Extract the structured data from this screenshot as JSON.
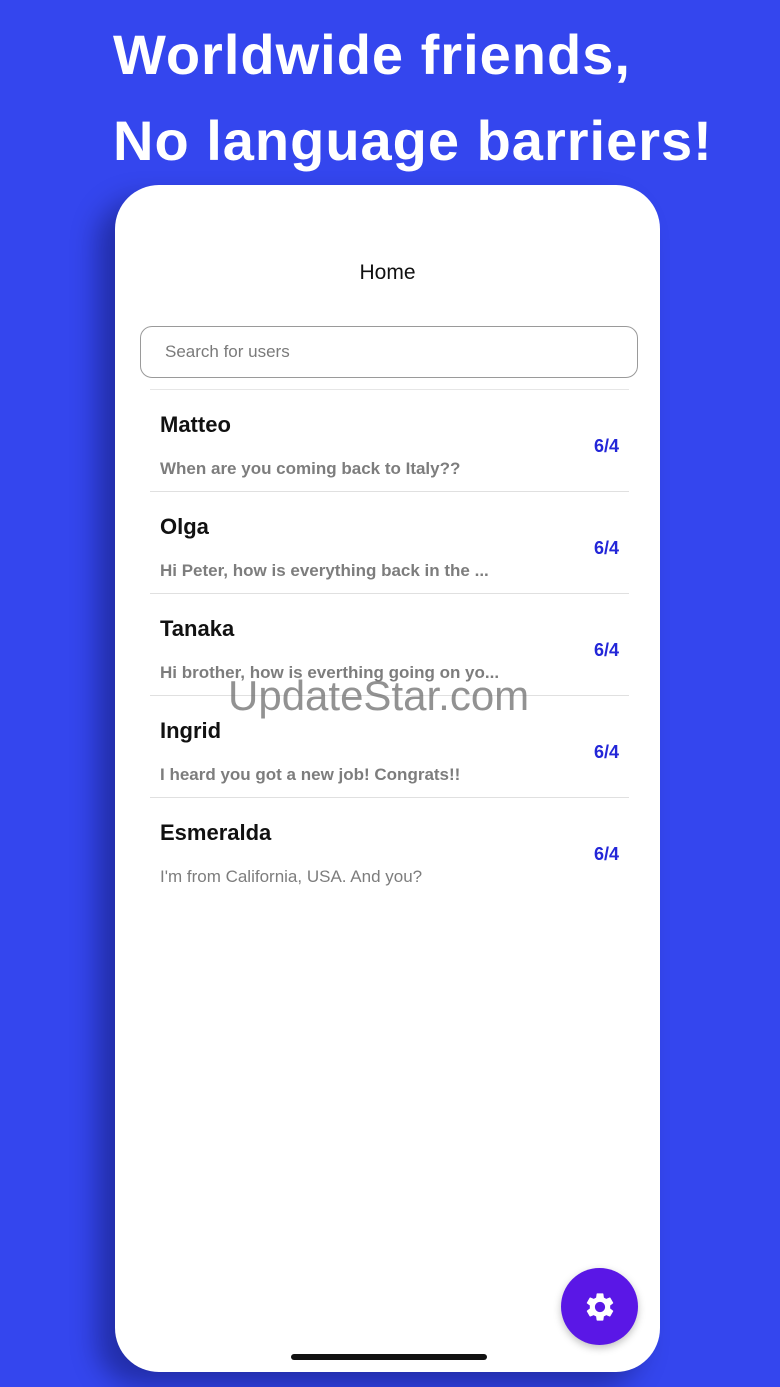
{
  "promo": {
    "line1": "Worldwide friends,",
    "line2": "No language barriers!"
  },
  "nav": {
    "title": "Home"
  },
  "search": {
    "placeholder": "Search for users",
    "value": ""
  },
  "conversations": [
    {
      "name": "Matteo",
      "preview": "When are you coming back to Italy??",
      "date": "6/4"
    },
    {
      "name": "Olga",
      "preview": "Hi Peter, how is everything back in the ...",
      "date": "6/4"
    },
    {
      "name": "Tanaka",
      "preview": "Hi brother, how is everthing going on yo...",
      "date": "6/4"
    },
    {
      "name": "Ingrid",
      "preview": "I heard you got a new job! Congrats!!",
      "date": "6/4"
    },
    {
      "name": "Esmeralda",
      "preview": "I'm from California, USA. And you?",
      "date": "6/4"
    }
  ],
  "watermark": "UpdateStar.com",
  "fab": {
    "icon": "gear-icon"
  },
  "colors": {
    "background": "#3446ee",
    "accent": "#2326d8",
    "fab": "#5a17e6"
  }
}
